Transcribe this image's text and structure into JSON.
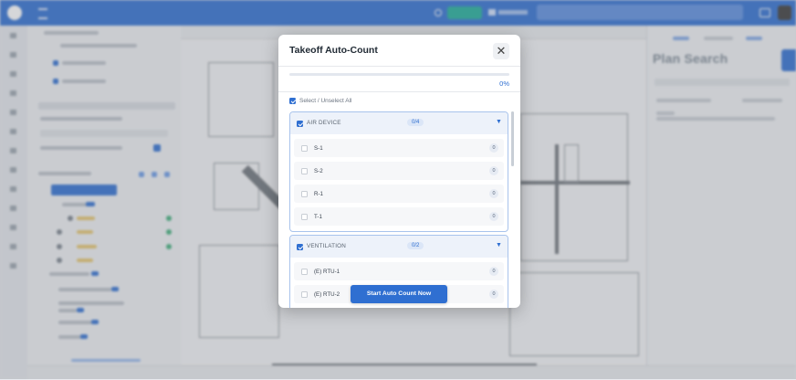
{
  "modal": {
    "title": "Takeoff Auto-Count",
    "close_glyph": "✕",
    "progress_fraction": 0.0,
    "progress_text": "0%",
    "select_all_label": "Select / Unselect All",
    "select_all_checked": true,
    "groups": [
      {
        "name": "AIR DEVICE",
        "count": "0/4",
        "checked": true,
        "chevron": "▼",
        "rows": [
          {
            "label": "S-1",
            "badge": "0",
            "checked": false
          },
          {
            "label": "S-2",
            "badge": "0",
            "checked": false
          },
          {
            "label": "R-1",
            "badge": "0",
            "checked": false
          },
          {
            "label": "T-1",
            "badge": "0",
            "checked": false
          }
        ]
      },
      {
        "name": "VENTILATION",
        "count": "0/2",
        "checked": true,
        "chevron": "▼",
        "rows": [
          {
            "label": "(E) RTU-1",
            "badge": "0",
            "checked": false
          },
          {
            "label": "(E) RTU-2",
            "badge": "0",
            "checked": false
          }
        ]
      }
    ],
    "start_button": "Start Auto Count Now"
  },
  "background": {
    "right_panel_title": "Plan Search"
  },
  "colors": {
    "primary": "#2f6fd1",
    "group_border": "#a8c3ec",
    "group_header_bg": "#edf2fa"
  }
}
